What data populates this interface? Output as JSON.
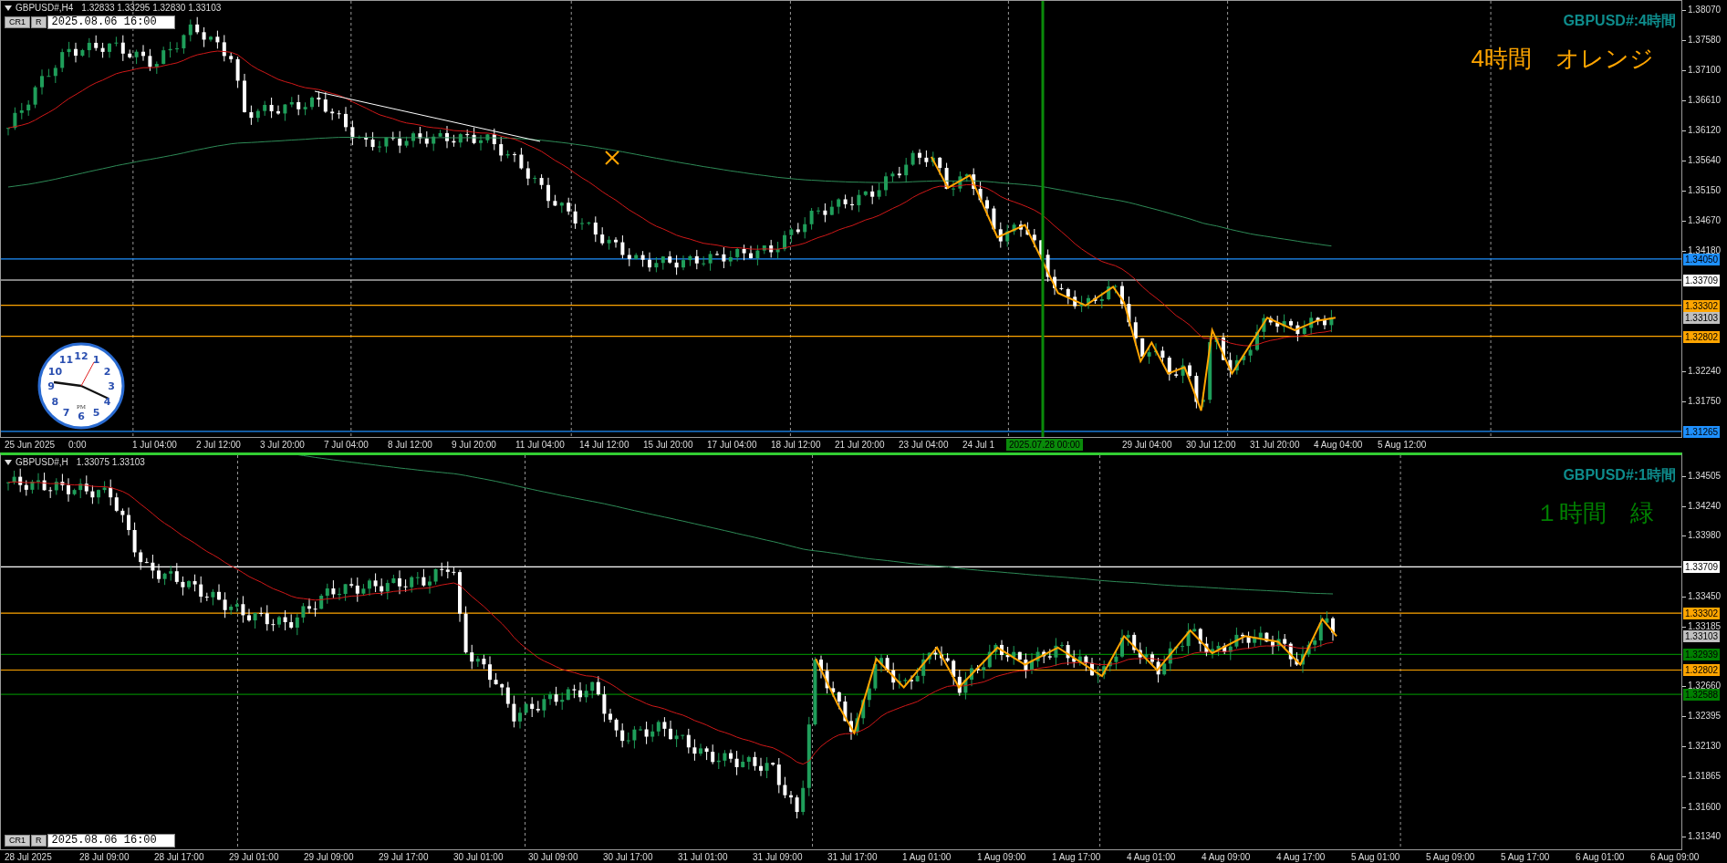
{
  "charts": [
    {
      "active": false,
      "symbol": "GBPUSD#,H4",
      "quote": "1.32833 1.33295 1.32830 1.33103",
      "toolbar": {
        "buttons": [
          "CR1",
          "R"
        ],
        "datetime": "2025.08.06 16:00"
      },
      "caption": "GBPUSD#:4時間",
      "note": "4時間　オレンジ",
      "price_ticks": [
        "1.38070",
        "1.37580",
        "1.37100",
        "1.36610",
        "1.36120",
        "1.35640",
        "1.35150",
        "1.34670",
        "1.34180",
        "1.32240",
        "1.31750"
      ],
      "price_markers": [
        {
          "value": "1.34050",
          "color": "#1e90ff",
          "kind": "level"
        },
        {
          "value": "1.33709",
          "color": "#ffffff",
          "kind": "level"
        },
        {
          "value": "1.33302",
          "color": "#ffa500",
          "kind": "level"
        },
        {
          "value": "1.33103",
          "color": "#c0c0c0",
          "kind": "bid"
        },
        {
          "value": "1.32802",
          "color": "#ffa500",
          "kind": "level"
        },
        {
          "value": "1.31265",
          "color": "#1e90ff",
          "kind": "level"
        }
      ],
      "time_labels": [
        "25 Jun 2025",
        "0:00",
        "1 Jul 04:00",
        "2 Jul 12:00",
        "3 Jul 20:00",
        "7 Jul 04:00",
        "8 Jul 12:00",
        "9 Jul 20:00",
        "11 Jul 04:00",
        "14 Jul 12:00",
        "15 Jul 20:00",
        "17 Jul 04:00",
        "18 Jul 12:00",
        "21 Jul 20:00",
        "23 Jul 04:00",
        "24 Jul 1",
        "29 Jul 04:00",
        "30 Jul 12:00",
        "31 Jul 20:00",
        "4 Aug 04:00",
        "5 Aug 12:00"
      ],
      "cursor_time": "2025.07.28 00:00"
    },
    {
      "active": true,
      "symbol": "GBPUSD#,H",
      "quote": "1.33075 1.33103",
      "toolbar": {
        "buttons": [
          "CR1",
          "R"
        ],
        "datetime": "2025.08.06 16:00"
      },
      "caption": "GBPUSD#:1時間",
      "note": "１時間　緑",
      "price_ticks": [
        "1.34505",
        "1.34240",
        "1.33980",
        "1.33450",
        "1.33185",
        "1.32660",
        "1.32395",
        "1.32130",
        "1.31865",
        "1.31600",
        "1.31340"
      ],
      "price_markers": [
        {
          "value": "1.33709",
          "color": "#ffffff",
          "kind": "level"
        },
        {
          "value": "1.33302",
          "color": "#ffa500",
          "kind": "level"
        },
        {
          "value": "1.33103",
          "color": "#c0c0c0",
          "kind": "bid"
        },
        {
          "value": "1.32939",
          "color": "#008000",
          "kind": "level"
        },
        {
          "value": "1.32802",
          "color": "#ffa500",
          "kind": "level"
        },
        {
          "value": "1.32588",
          "color": "#008000",
          "kind": "level"
        }
      ],
      "time_labels": [
        "28 Jul 2025",
        "28 Jul 09:00",
        "28 Jul 17:00",
        "29 Jul 01:00",
        "29 Jul 09:00",
        "29 Jul 17:00",
        "30 Jul 01:00",
        "30 Jul 09:00",
        "30 Jul 17:00",
        "31 Jul 01:00",
        "31 Jul 09:00",
        "31 Jul 17:00",
        "1 Aug 01:00",
        "1 Aug 09:00",
        "1 Aug 17:00",
        "4 Aug 01:00",
        "4 Aug 09:00",
        "4 Aug 17:00",
        "5 Aug 01:00",
        "5 Aug 09:00",
        "5 Aug 17:00",
        "6 Aug 01:00",
        "6 Aug 09:00"
      ]
    }
  ],
  "clock": {
    "numerals": [
      "12",
      "11",
      "1",
      "10",
      "2",
      "9",
      "3",
      "8",
      "4",
      "7",
      "5",
      "6"
    ],
    "meridiem": "PM"
  }
}
